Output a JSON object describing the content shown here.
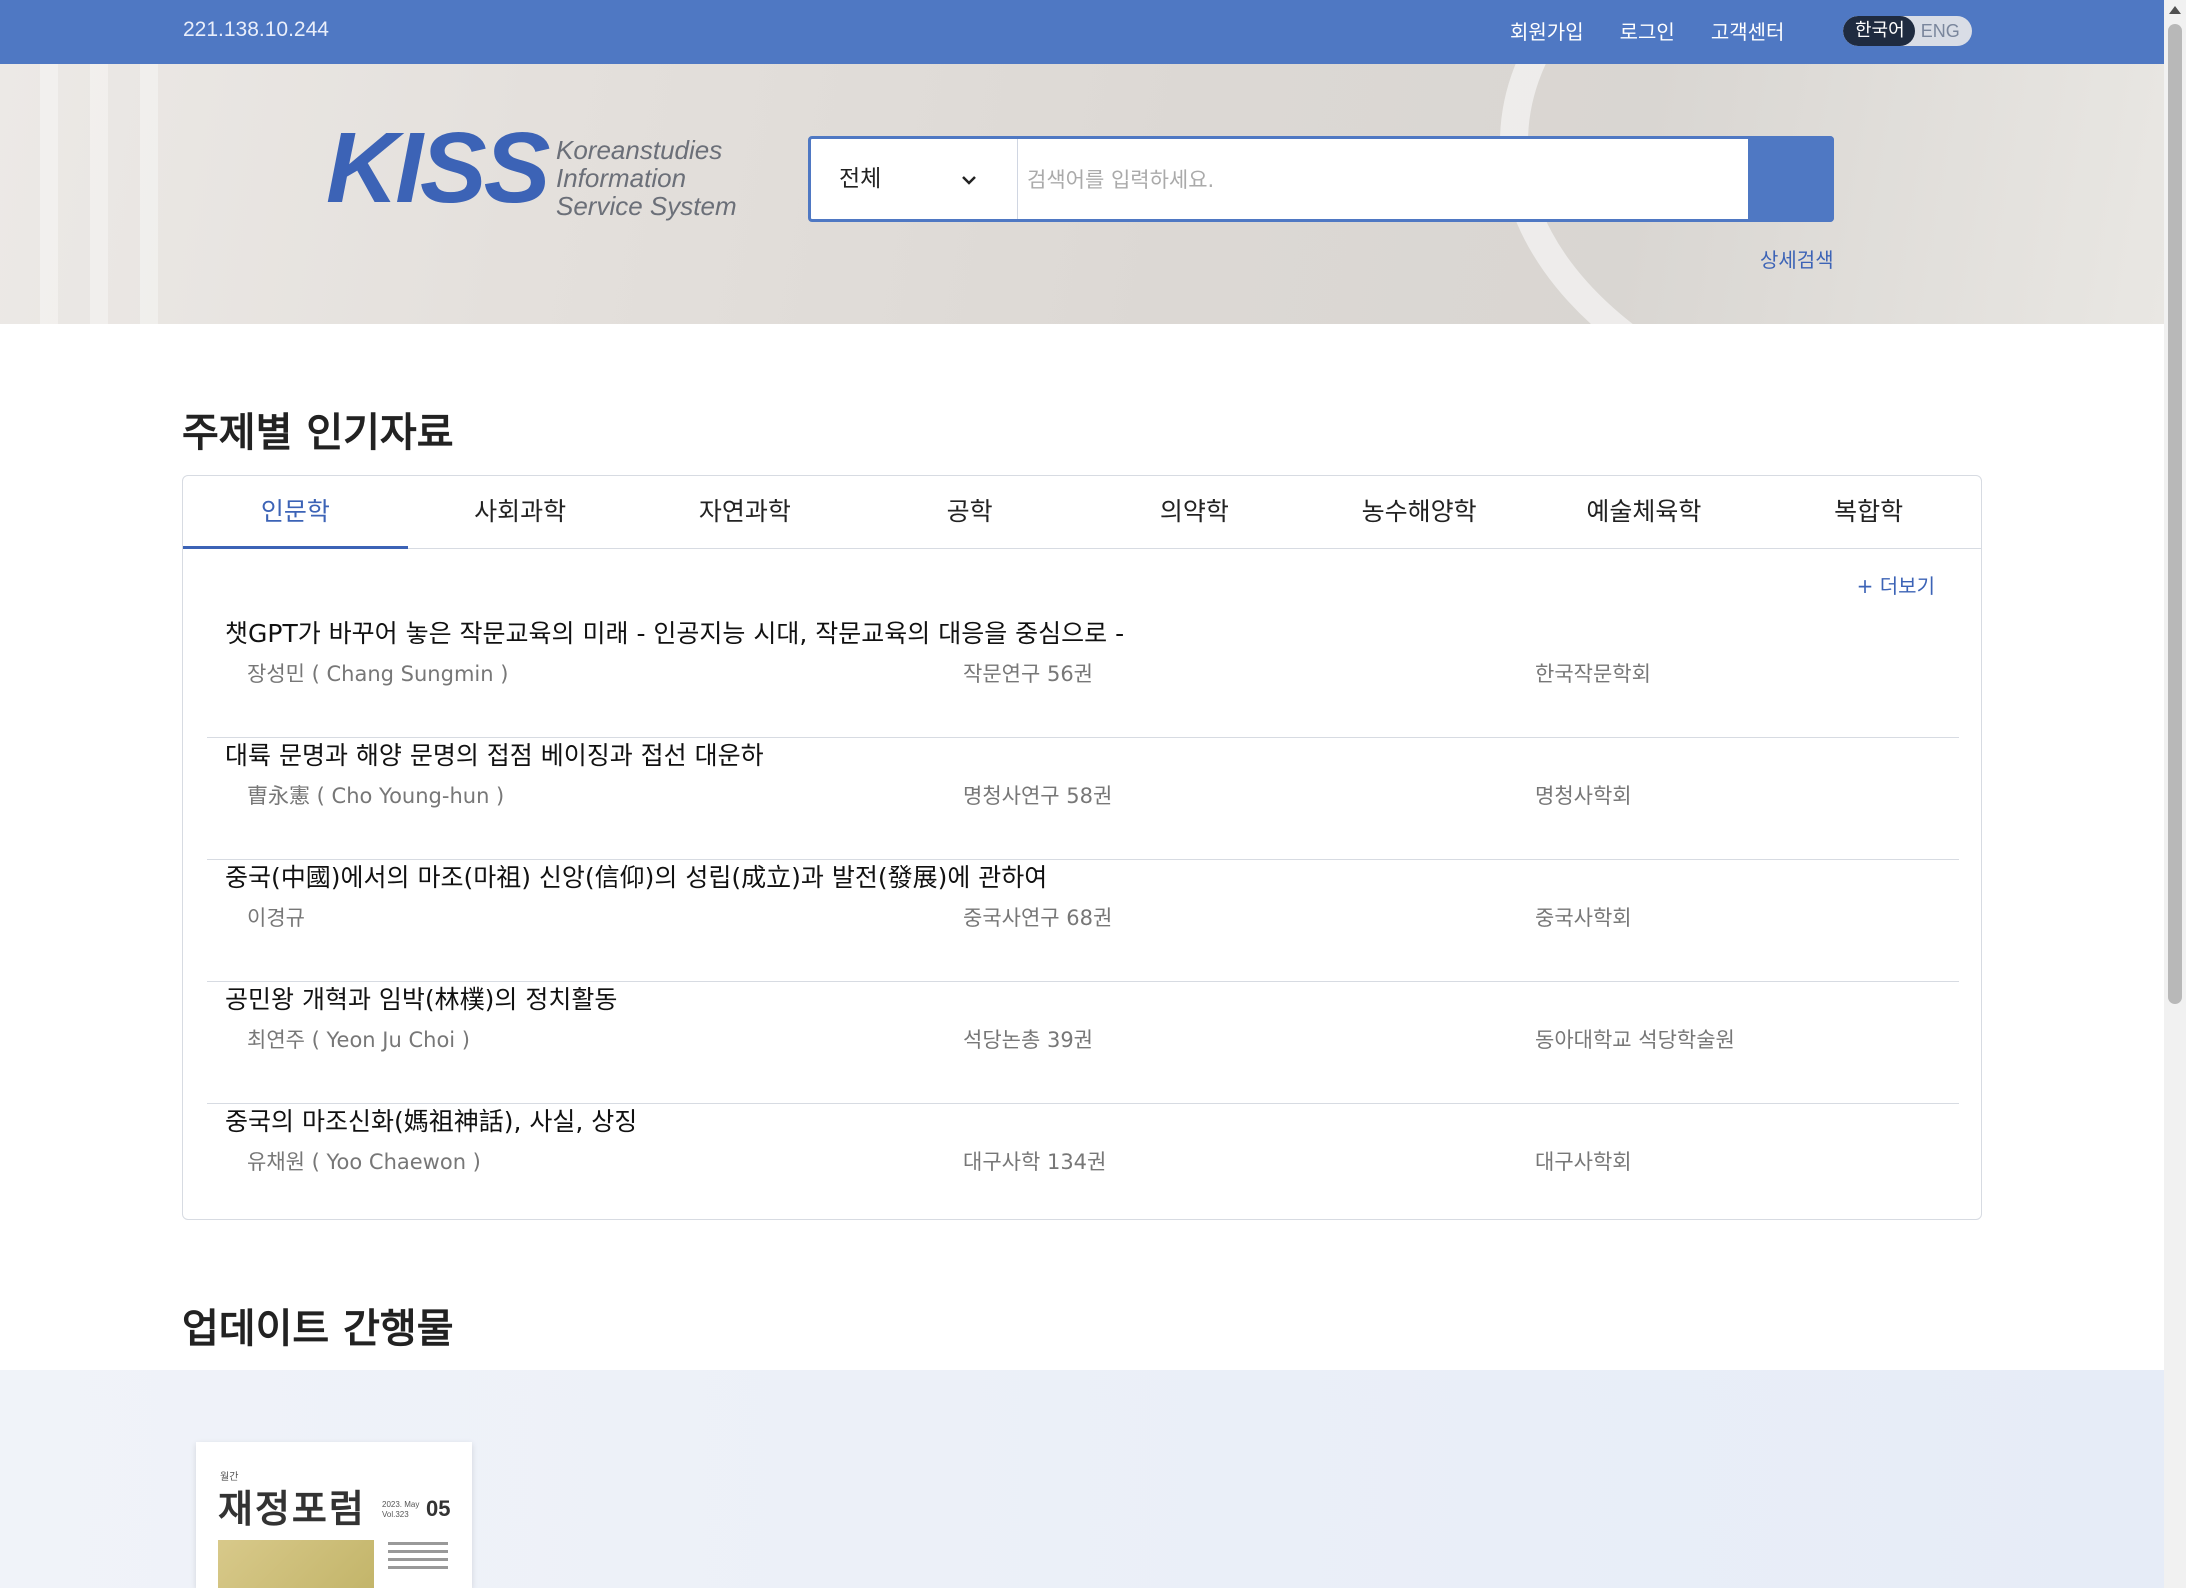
{
  "topbar": {
    "ip": "221.138.10.244",
    "links": [
      "회원가입",
      "로그인",
      "고객센터"
    ],
    "lang_ko": "한국어",
    "lang_en": "ENG"
  },
  "header": {
    "logo_text": "KISS",
    "logo_sub": [
      "Koreanstudies",
      "Information",
      "Service System"
    ],
    "search_scope": "전체",
    "search_placeholder": "검색어를 입력하세요.",
    "advanced_search": "상세검색"
  },
  "popular": {
    "title": "주제별 인기자료",
    "tabs": [
      "인문학",
      "사회과학",
      "자연과학",
      "공학",
      "의약학",
      "농수해양학",
      "예술체육학",
      "복합학"
    ],
    "active_tab": "인문학",
    "more": "+ 더보기",
    "items": [
      {
        "title": "챗GPT가 바꾸어 놓은 작문교육의 미래 - 인공지능 시대, 작문교육의 대응을 중심으로 -",
        "author": "장성민 ( Chang Sungmin )",
        "journal": "작문연구 56권",
        "publisher": "한국작문학회"
      },
      {
        "title": "대륙 문명과 해양 문명의 접점 베이징과 접선 대운하",
        "author": "曺永憲 ( Cho Young-hun )",
        "journal": "명청사연구 58권",
        "publisher": "명청사학회"
      },
      {
        "title": "중국(中國)에서의 마조(마祖) 신앙(信仰)의 성립(成立)과 발전(發展)에 관하여",
        "author": "이경규",
        "journal": "중국사연구 68권",
        "publisher": "중국사학회"
      },
      {
        "title": "공민왕 개혁과 임박(林樸)의 정치활동",
        "author": "최연주 ( Yeon Ju Choi )",
        "journal": "석당논총 39권",
        "publisher": "동아대학교 석당학술원"
      },
      {
        "title": "중국의 마조신화(媽祖神話), 사실, 상징",
        "author": "유채원 ( Yoo Chaewon )",
        "journal": "대구사학 134권",
        "publisher": "대구사학회"
      }
    ]
  },
  "updates": {
    "title": "업데이트 간행물",
    "cover_small": "월간",
    "cover_title": "재정포럼",
    "cover_meta": [
      "2023. May",
      "Vol.323"
    ],
    "cover_num": "05"
  }
}
